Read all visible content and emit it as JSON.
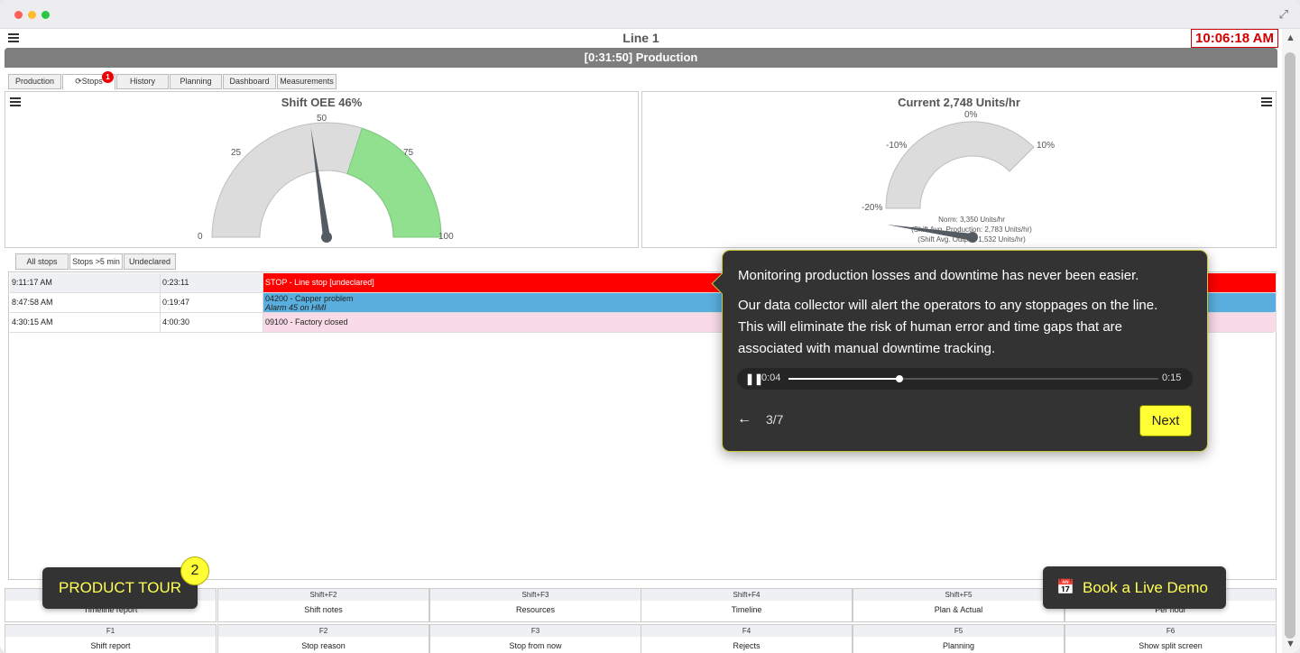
{
  "window": {
    "controls": [
      "close",
      "minimize",
      "maximize"
    ],
    "expand_icon": "expand-icon"
  },
  "header": {
    "title": "Line 1",
    "clock": "10:06:18 AM",
    "status": "[0:31:50] Production"
  },
  "tabs": [
    {
      "label": "Production"
    },
    {
      "label": "Stops",
      "icon": "refresh-icon",
      "badge": "1",
      "active": true
    },
    {
      "label": "History"
    },
    {
      "label": "Planning"
    },
    {
      "label": "Dashboard"
    },
    {
      "label": "Measurements"
    }
  ],
  "oee_gauge": {
    "title": "Shift OEE 46%",
    "value": 46,
    "min": 0,
    "max": 100,
    "green_from": 60,
    "ticks": [
      "0",
      "25",
      "50",
      "75",
      "100"
    ]
  },
  "rate_gauge": {
    "title": "Current 2,748 Units/hr",
    "value_percent": -18,
    "ticks": [
      "-20%",
      "-10%",
      "0%",
      "10%"
    ],
    "norm": "Norm: 3,350 Units/hr",
    "shift_avg_production": "(Shift Avg. Production: 2,783 Units/hr)",
    "shift_avg_output": "(Shift Avg. Output: 1,532 Units/hr)"
  },
  "stop_filters": [
    {
      "label": "All stops"
    },
    {
      "label": "Stops >5 min",
      "active": true
    },
    {
      "label": "Undeclared"
    }
  ],
  "stops": [
    {
      "time": "9:11:17 AM",
      "duration": "0:23:11",
      "reason": "STOP - Line stop [undeclared]",
      "reason2": "",
      "color": "#ff0000",
      "text_color": "#ffffff"
    },
    {
      "time": "8:47:58 AM",
      "duration": "0:19:47",
      "reason": "04200 - Capper problem",
      "reason2": "Alarm 45 on HMI",
      "color": "#5aaede",
      "text_color": "#111111"
    },
    {
      "time": "4:30:15 AM",
      "duration": "4:00:30",
      "reason": "09100 - Factory closed",
      "reason2": "",
      "color": "#f9dbe7",
      "text_color": "#111111"
    }
  ],
  "fkeys_row1": [
    {
      "key": "",
      "label": "Timeline report"
    },
    {
      "key": "Shift+F2",
      "label": "Shift notes"
    },
    {
      "key": "Shift+F3",
      "label": "Resources"
    },
    {
      "key": "Shift+F4",
      "label": "Timeline"
    },
    {
      "key": "Shift+F5",
      "label": "Plan & Actual"
    },
    {
      "key": "",
      "label": "Per hour"
    }
  ],
  "fkeys_row2": [
    {
      "key": "F1",
      "label": "Shift report"
    },
    {
      "key": "F2",
      "label": "Stop reason"
    },
    {
      "key": "F3",
      "label": "Stop from now"
    },
    {
      "key": "F4",
      "label": "Rejects"
    },
    {
      "key": "F5",
      "label": "Planning"
    },
    {
      "key": "F6",
      "label": "Show split screen"
    }
  ],
  "tour": {
    "line1": "Monitoring production losses and downtime has never been easier.",
    "line2": "Our data collector will alert the operators to any stoppages on the line.",
    "line3": "This will eliminate the risk of human error and time gaps that are",
    "line4": "associated with manual downtime tracking.",
    "time_current": "0:04",
    "time_total": "0:15",
    "progress": 0.3,
    "step": "3/7",
    "next_label": "Next"
  },
  "product_tour": {
    "label": "PRODUCT TOUR",
    "badge": "2"
  },
  "demo_button": {
    "label": "Book a Live Demo",
    "icon": "calendar-icon"
  },
  "colors": {
    "accent_yellow": "#ffff33",
    "status_gray": "#7e7e7e",
    "gauge_green": "#90e090",
    "clock_red": "#d00000"
  }
}
